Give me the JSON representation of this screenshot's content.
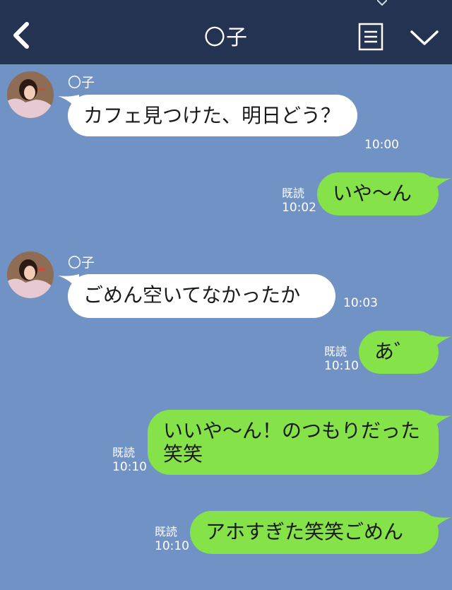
{
  "header": {
    "title": "〇子"
  },
  "contact": {
    "name": "〇子"
  },
  "messages": [
    {
      "side": "in",
      "text": "カフェ見つけた、明日どう？",
      "time": "10:00"
    },
    {
      "side": "out",
      "text": "いや〜ん",
      "read": "既読",
      "time": "10:02"
    },
    {
      "side": "in",
      "text": "ごめん空いてなかったか",
      "time": "10:03"
    },
    {
      "side": "out",
      "text": "あ゛",
      "read": "既読",
      "time": "10:10"
    },
    {
      "side": "out",
      "text": "いいや〜ん！のつもりだった笑笑",
      "read": "既読",
      "time": "10:10"
    },
    {
      "side": "out",
      "text": "アホすぎた笑笑ごめん",
      "read": "既読",
      "time": "10:10"
    }
  ],
  "colors": {
    "background": "#7192c4",
    "header": "#243352",
    "outgoing_bubble": "#86e249",
    "incoming_bubble": "#ffffff"
  },
  "icons": {
    "back": "chevron-left-icon",
    "menu": "list-icon",
    "expand": "chevron-down-icon"
  }
}
